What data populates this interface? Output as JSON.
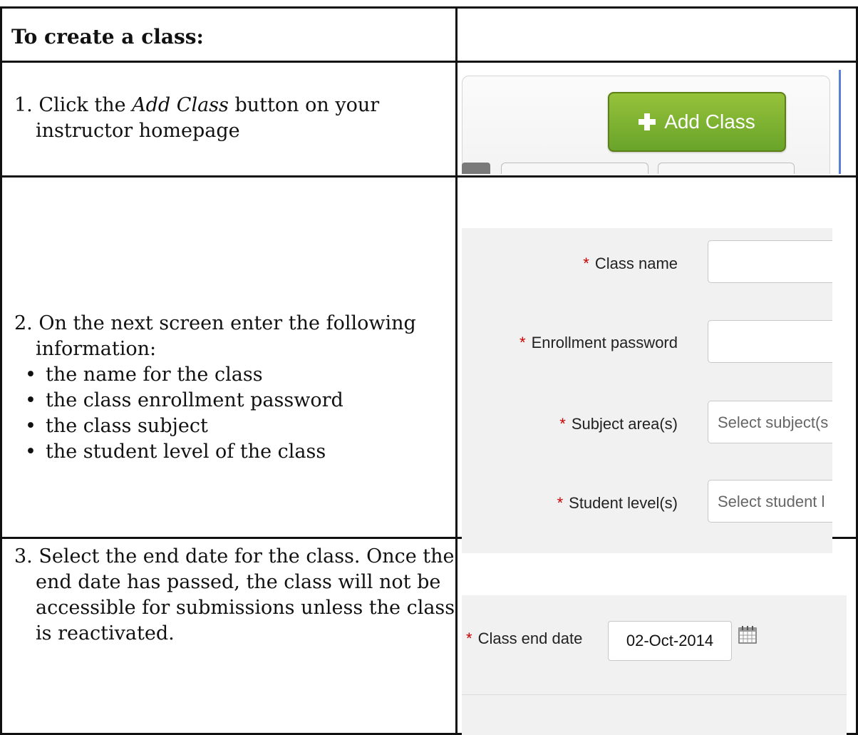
{
  "header": {
    "title": "To create a class:"
  },
  "steps": [
    {
      "text_before": "1. Click the ",
      "emphasis": "Add Class",
      "text_after": " button on your instructor homepage"
    },
    {
      "text": "2. On the next screen enter the following information:"
    },
    {
      "text": "3. Select the end date for the class. Once the end date has passed, the class will not be accessible for submissions unless the class is reactivated."
    }
  ],
  "bullets": [
    "the name for the class",
    "the class enrollment password",
    "the class subject",
    "the student level of the class"
  ],
  "screenshot1": {
    "button_label": "Add Class",
    "button_icon": "plus-icon"
  },
  "screenshot2": {
    "required_marker": "*",
    "fields": [
      {
        "label": "Class name",
        "value": ""
      },
      {
        "label": "Enrollment password",
        "value": ""
      },
      {
        "label": "Subject area(s)",
        "placeholder": "Select subject(s"
      },
      {
        "label": "Student level(s)",
        "placeholder": "Select student l"
      }
    ]
  },
  "screenshot3": {
    "required_marker": "*",
    "label": "Class end date",
    "date_value": "02-Oct-2014",
    "icon": "calendar-icon"
  },
  "colors": {
    "button_green": "#7db532",
    "required_red": "#cc0000",
    "form_bg": "#f1f1f1"
  }
}
